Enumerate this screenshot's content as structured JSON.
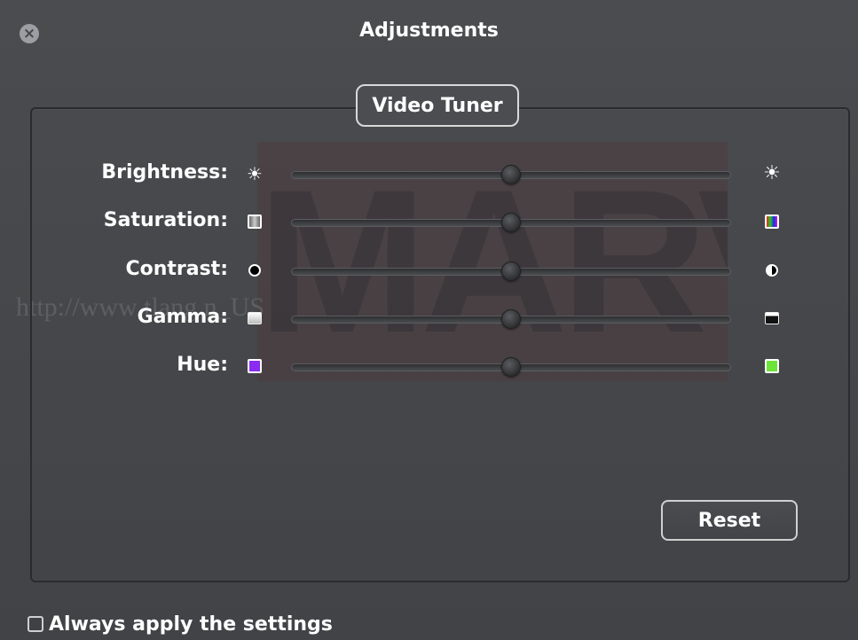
{
  "window": {
    "title": "Adjustments",
    "close_icon": "close-icon"
  },
  "watermark": {
    "logo_text": "MARVEL",
    "url_text": "http://www                                                      tlang         n_US"
  },
  "tuner": {
    "tab_label": "Video Tuner",
    "sliders": [
      {
        "key": "brightness",
        "label": "Brightness:",
        "left_icon": "sun-small-icon",
        "right_icon": "sun-large-icon",
        "value": 0.5
      },
      {
        "key": "saturation",
        "label": "Saturation:",
        "left_icon": "grayscale-square-icon",
        "right_icon": "color-square-icon",
        "value": 0.5
      },
      {
        "key": "contrast",
        "label": "Contrast:",
        "left_icon": "black-circle-icon",
        "right_icon": "half-circle-icon",
        "value": 0.5
      },
      {
        "key": "gamma",
        "label": "Gamma:",
        "left_icon": "light-gradient-square-icon",
        "right_icon": "dark-gradient-square-icon",
        "value": 0.5
      },
      {
        "key": "hue",
        "label": "Hue:",
        "left_icon": "purple-square-icon",
        "right_icon": "green-square-icon",
        "value": 0.5
      }
    ],
    "reset_label": "Reset"
  },
  "footer": {
    "always_apply_label": "Always apply the settings",
    "always_apply_checked": false
  },
  "colors": {
    "hue_left": "#8b2cf2",
    "hue_right": "#6ee33a",
    "panel_background": "#46484b"
  }
}
